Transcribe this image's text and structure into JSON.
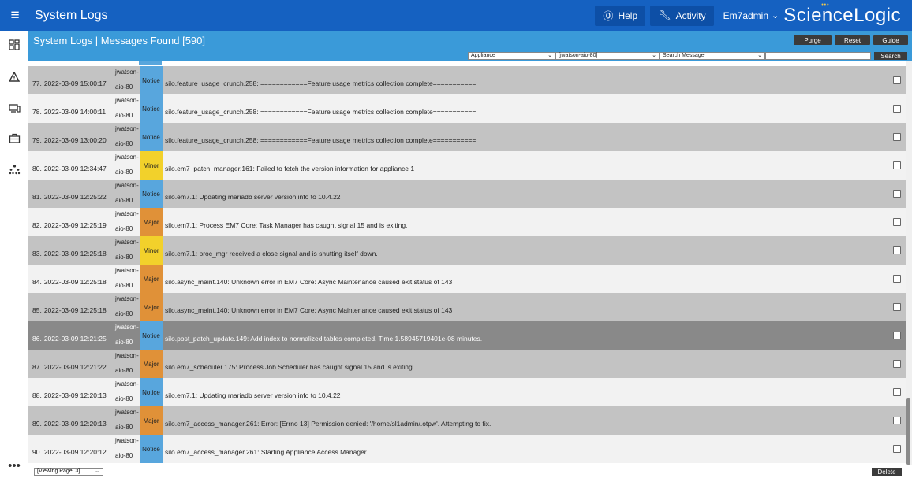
{
  "topbar": {
    "menu_icon": "hamburger-icon",
    "title": "System Logs",
    "help_label": "Help",
    "activity_label": "Activity",
    "user": "Em7admin",
    "logo": "ScienceLogic"
  },
  "sidebar": {
    "icons": [
      "dashboard-icon",
      "alert-triangle-icon",
      "devices-icon",
      "toolbox-icon",
      "topology-icon",
      "more-icon"
    ]
  },
  "header": {
    "title": "System Logs | Messages Found [590]",
    "buttons": {
      "purge": "Purge",
      "reset": "Reset",
      "guide": "Guide"
    },
    "filters": {
      "source": "Appliance",
      "appliance": "[jwatson-aio-80]",
      "search_field": "Search Message",
      "search_value": "",
      "search_button": "Search"
    }
  },
  "rows": [
    {
      "num": "77.",
      "date": "2022-03-09 15:00:17",
      "host1": "jwatson-",
      "host2": "aio-80",
      "severity": "Notice",
      "message": "silo.feature_usage_crunch.258: ============Feature usage metrics collection complete==========="
    },
    {
      "num": "78.",
      "date": "2022-03-09 14:00:11",
      "host1": "jwatson-",
      "host2": "aio-80",
      "severity": "Notice",
      "message": "silo.feature_usage_crunch.258: ============Feature usage metrics collection complete==========="
    },
    {
      "num": "79.",
      "date": "2022-03-09 13:00:20",
      "host1": "jwatson-",
      "host2": "aio-80",
      "severity": "Notice",
      "message": "silo.feature_usage_crunch.258: ============Feature usage metrics collection complete==========="
    },
    {
      "num": "80.",
      "date": "2022-03-09 12:34:47",
      "host1": "jwatson-",
      "host2": "aio-80",
      "severity": "Minor",
      "message": "silo.em7_patch_manager.161: Failed to fetch the version information for appliance 1"
    },
    {
      "num": "81.",
      "date": "2022-03-09 12:25:22",
      "host1": "jwatson-",
      "host2": "aio-80",
      "severity": "Notice",
      "message": "silo.em7.1: Updating mariadb server version info to 10.4.22"
    },
    {
      "num": "82.",
      "date": "2022-03-09 12:25:19",
      "host1": "jwatson-",
      "host2": "aio-80",
      "severity": "Major",
      "message": "silo.em7.1: Process EM7 Core: Task Manager has caught signal 15 and is exiting."
    },
    {
      "num": "83.",
      "date": "2022-03-09 12:25:18",
      "host1": "jwatson-",
      "host2": "aio-80",
      "severity": "Minor",
      "message": "silo.em7.1: proc_mgr received a close signal and is shutting itself down."
    },
    {
      "num": "84.",
      "date": "2022-03-09 12:25:18",
      "host1": "jwatson-",
      "host2": "aio-80",
      "severity": "Major",
      "message": "silo.async_maint.140: Unknown error in EM7 Core: Async Maintenance caused exit status of 143"
    },
    {
      "num": "85.",
      "date": "2022-03-09 12:25:18",
      "host1": "jwatson-",
      "host2": "aio-80",
      "severity": "Major",
      "message": "silo.async_maint.140: Unknown error in EM7 Core: Async Maintenance caused exit status of 143"
    },
    {
      "num": "86.",
      "date": "2022-03-09 12:21:25",
      "host1": "jwatson-",
      "host2": "aio-80",
      "severity": "Notice",
      "message": "silo.post_patch_update.149: Add index to normalized tables completed. Time 1.58945719401e-08 minutes."
    },
    {
      "num": "87.",
      "date": "2022-03-09 12:21:22",
      "host1": "jwatson-",
      "host2": "aio-80",
      "severity": "Major",
      "message": "silo.em7_scheduler.175: Process Job Scheduler has caught signal 15 and is exiting."
    },
    {
      "num": "88.",
      "date": "2022-03-09 12:20:13",
      "host1": "jwatson-",
      "host2": "aio-80",
      "severity": "Notice",
      "message": "silo.em7.1: Updating mariadb server version info to 10.4.22"
    },
    {
      "num": "89.",
      "date": "2022-03-09 12:20:13",
      "host1": "jwatson-",
      "host2": "aio-80",
      "severity": "Major",
      "message": "silo.em7_access_manager.261: Error: [Errno 13] Permission denied: '/home/sl1admin/.otpw'. Attempting to fix."
    },
    {
      "num": "90.",
      "date": "2022-03-09 12:20:12",
      "host1": "jwatson-",
      "host2": "aio-80",
      "severity": "Notice",
      "message": "silo.em7_access_manager.261: Starting Appliance Access Manager"
    }
  ],
  "severity_colors": {
    "Notice": "#58a6dd",
    "Minor": "#f2d12b",
    "Major": "#e09138"
  },
  "footer": {
    "page_select": "[Viewing Page: 3]",
    "delete_label": "Delete"
  }
}
